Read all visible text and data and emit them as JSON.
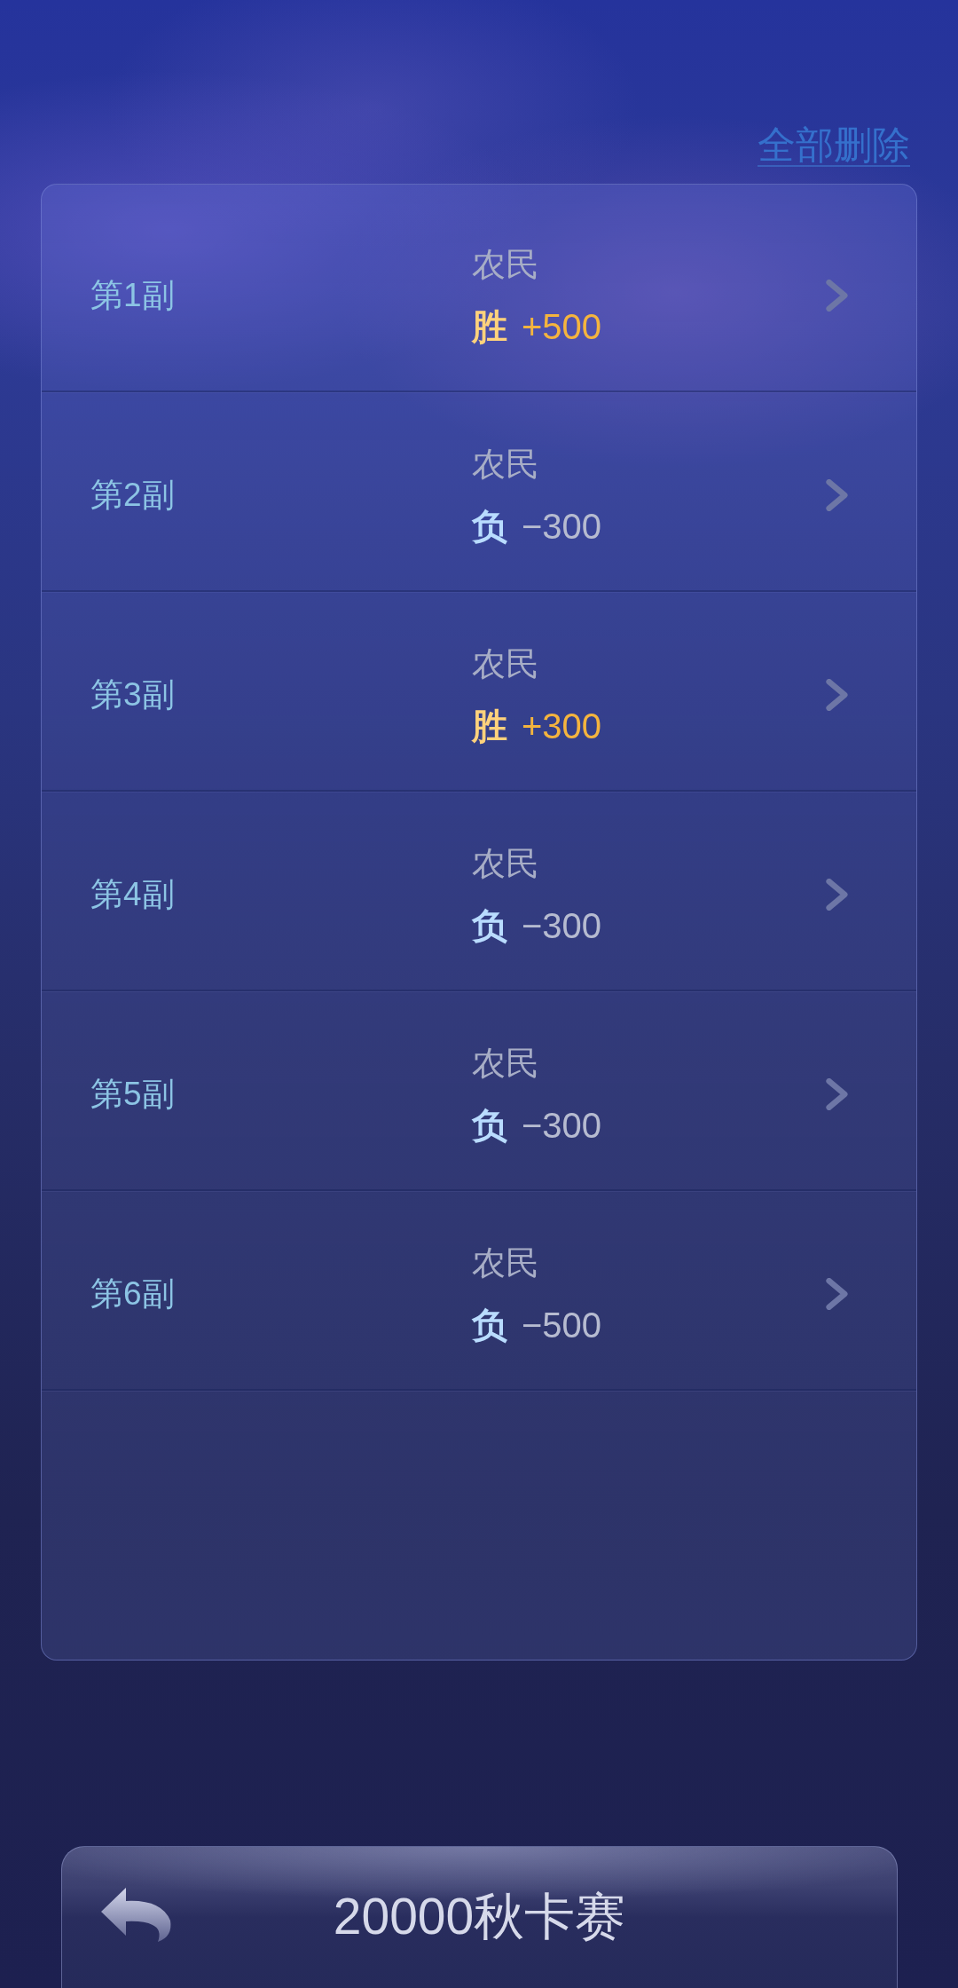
{
  "header": {
    "delete_all_link": "全部删除"
  },
  "games": [
    {
      "label": "第1副",
      "role": "农民",
      "kind": "win",
      "result": "胜",
      "score": "+500"
    },
    {
      "label": "第2副",
      "role": "农民",
      "kind": "loss",
      "result": "负",
      "score": "−300"
    },
    {
      "label": "第3副",
      "role": "农民",
      "kind": "win",
      "result": "胜",
      "score": "+300"
    },
    {
      "label": "第4副",
      "role": "农民",
      "kind": "loss",
      "result": "负",
      "score": "−300"
    },
    {
      "label": "第5副",
      "role": "农民",
      "kind": "loss",
      "result": "负",
      "score": "−300"
    },
    {
      "label": "第6副",
      "role": "农民",
      "kind": "loss",
      "result": "负",
      "score": "−500"
    }
  ],
  "footer": {
    "title": "20000秋卡赛"
  }
}
